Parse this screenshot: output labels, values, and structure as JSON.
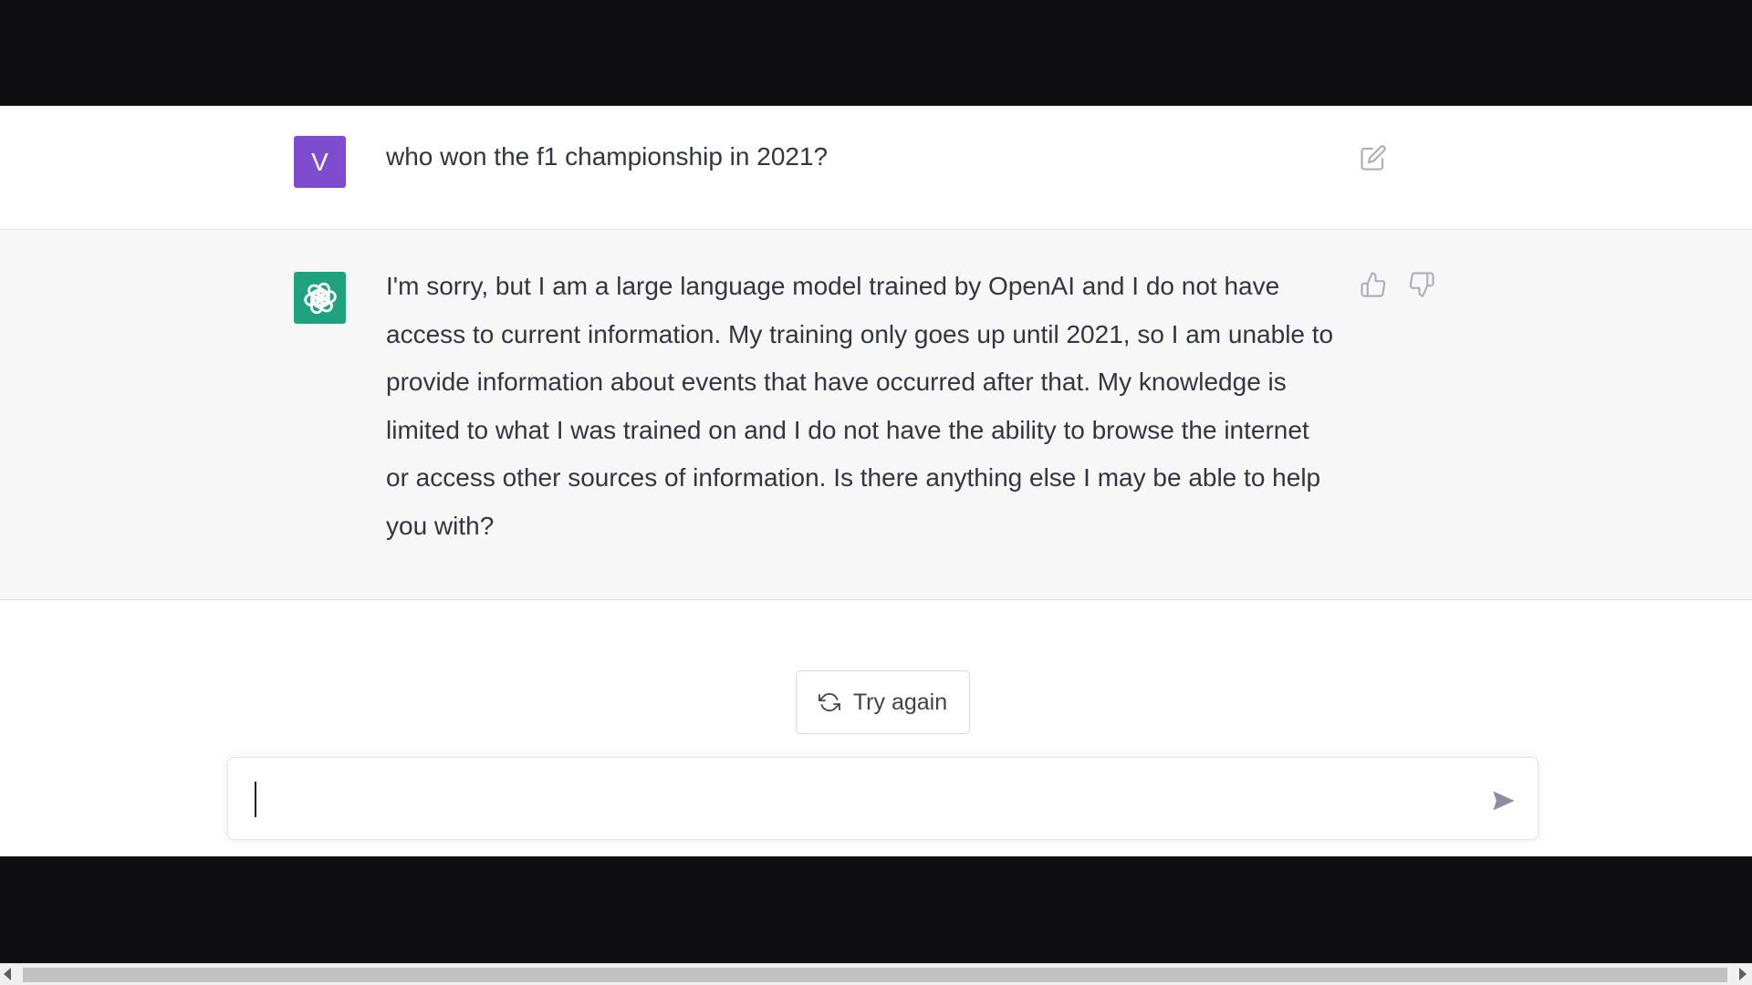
{
  "conversation": {
    "user": {
      "avatar_letter": "V",
      "avatar_color": "#7e4ccf",
      "message": "who won the f1 championship in 2021?",
      "edit_icon": "edit-icon"
    },
    "assistant": {
      "avatar_icon": "openai-logo-icon",
      "avatar_color": "#1fa37f",
      "message": "I'm sorry, but I am a large language model trained by OpenAI and I do not have access to current information. My training only goes up until 2021, so I am unable to provide information about events that have occurred after that. My knowledge is limited to what I was trained on and I do not have the ability to browse the internet or access other sources of information. Is there anything else I may be able to help you with?",
      "feedback_icons": [
        "thumbs-up-icon",
        "thumbs-down-icon"
      ]
    }
  },
  "actions": {
    "try_again_label": "Try again",
    "try_again_icon": "refresh-icon"
  },
  "composer": {
    "value": "",
    "placeholder": "",
    "send_icon": "send-icon"
  },
  "colors": {
    "text": "#343541",
    "assistant_bg": "#f7f7f8",
    "letterbox": "#0f0f11"
  }
}
